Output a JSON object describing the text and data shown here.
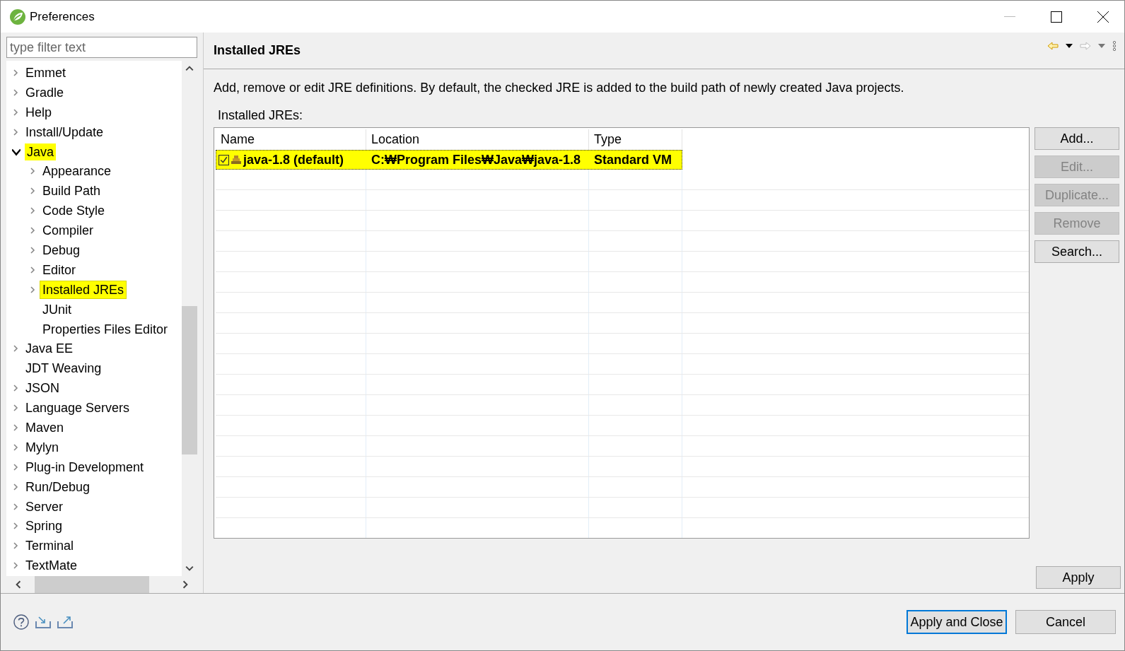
{
  "window": {
    "title": "Preferences"
  },
  "filter": {
    "placeholder": "type filter text"
  },
  "tree": [
    {
      "label": "Emmet",
      "expanded": false,
      "selected": false
    },
    {
      "label": "Gradle",
      "expanded": false,
      "selected": false
    },
    {
      "label": "Help",
      "expanded": false,
      "selected": false
    },
    {
      "label": "Install/Update",
      "expanded": false,
      "selected": false
    },
    {
      "label": "Java",
      "expanded": true,
      "selected": false,
      "highlighted": true,
      "children": [
        {
          "label": "Appearance",
          "expanded": false,
          "selected": false
        },
        {
          "label": "Build Path",
          "expanded": false,
          "selected": false
        },
        {
          "label": "Code Style",
          "expanded": false,
          "selected": false
        },
        {
          "label": "Compiler",
          "expanded": false,
          "selected": false
        },
        {
          "label": "Debug",
          "expanded": false,
          "selected": false
        },
        {
          "label": "Editor",
          "expanded": false,
          "selected": false
        },
        {
          "label": "Installed JREs",
          "expanded": false,
          "selected": true,
          "highlighted": true
        },
        {
          "label": "JUnit",
          "selected": false
        },
        {
          "label": "Properties Files Editor",
          "selected": false
        }
      ]
    },
    {
      "label": "Java EE",
      "expanded": false,
      "selected": false
    },
    {
      "label": "JDT Weaving",
      "selected": false
    },
    {
      "label": "JSON",
      "expanded": false,
      "selected": false
    },
    {
      "label": "Language Servers",
      "expanded": false,
      "selected": false
    },
    {
      "label": "Maven",
      "expanded": false,
      "selected": false
    },
    {
      "label": "Mylyn",
      "expanded": false,
      "selected": false
    },
    {
      "label": "Plug-in Development",
      "expanded": false,
      "selected": false
    },
    {
      "label": "Run/Debug",
      "expanded": false,
      "selected": false
    },
    {
      "label": "Server",
      "expanded": false,
      "selected": false
    },
    {
      "label": "Spring",
      "expanded": false,
      "selected": false
    },
    {
      "label": "Terminal",
      "expanded": false,
      "selected": false
    },
    {
      "label": "TextMate",
      "expanded": false,
      "selected": false
    }
  ],
  "page": {
    "title": "Installed JREs",
    "description": "Add, remove or edit JRE definitions. By default, the checked JRE is added to the build path of newly created Java projects.",
    "table_label": "Installed JREs:"
  },
  "table": {
    "columns": [
      "Name",
      "Location",
      "Type"
    ],
    "rows": [
      {
        "name": "java-1.8 (default)",
        "location": "C:₩Program Files₩Java₩java-1.8",
        "type": "Standard VM",
        "checked": true,
        "selected": true
      }
    ]
  },
  "side_buttons": [
    {
      "label": "Add...",
      "disabled": false
    },
    {
      "label": "Edit...",
      "disabled": true
    },
    {
      "label": "Duplicate...",
      "disabled": true
    },
    {
      "label": "Remove",
      "disabled": true
    },
    {
      "label": "Search...",
      "disabled": false
    }
  ],
  "apply_button": "Apply",
  "footer_buttons": [
    {
      "label": "Apply and Close",
      "default": true
    },
    {
      "label": "Cancel",
      "default": false
    }
  ]
}
